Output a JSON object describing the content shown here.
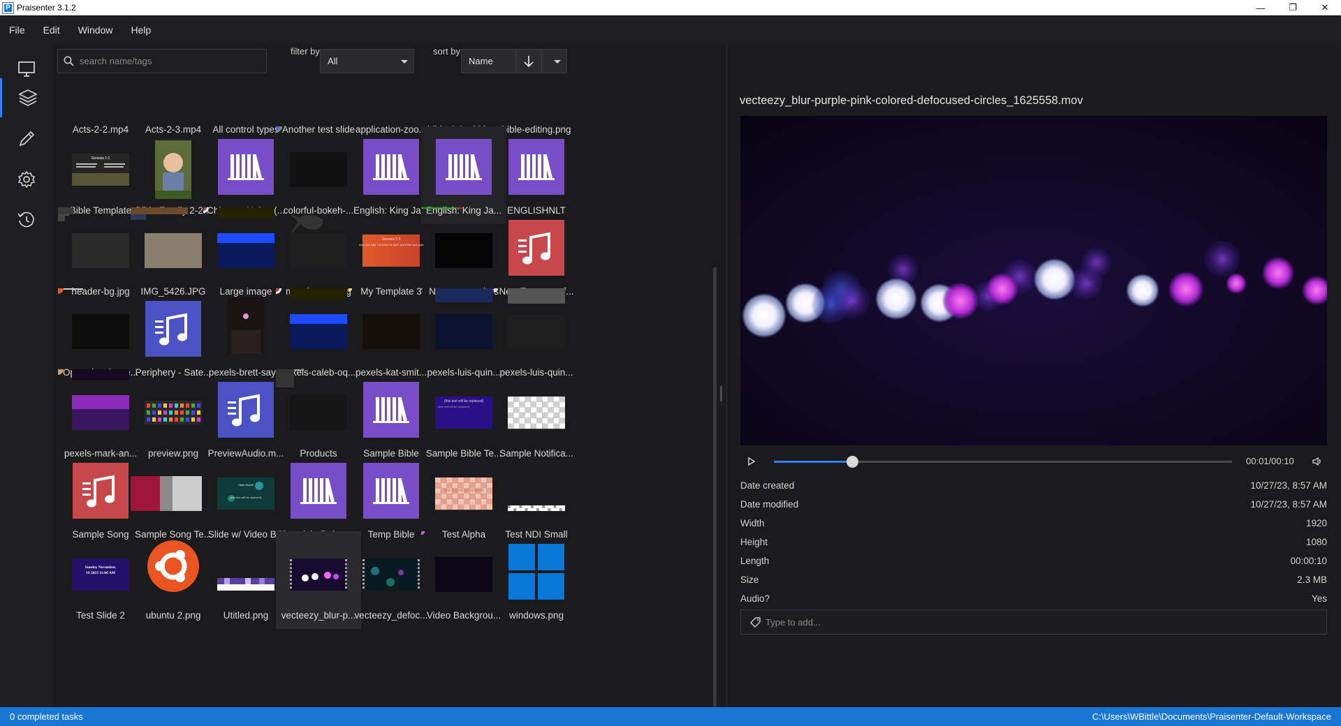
{
  "window": {
    "title": "Praisenter 3.1.2",
    "minimize": "—",
    "maximize": "❐",
    "close": "✕"
  },
  "menu": [
    "File",
    "Edit",
    "Window",
    "Help"
  ],
  "rail": [
    {
      "name": "presentation-icon"
    },
    {
      "name": "library-icon",
      "active": true
    },
    {
      "name": "edit-icon"
    },
    {
      "name": "settings-icon"
    },
    {
      "name": "history-icon"
    }
  ],
  "toolbar": {
    "search_placeholder": "search name/tags",
    "filter_label": "filter by",
    "filter_value": "All",
    "sort_label": "sort by",
    "sort_value": "Name"
  },
  "library": {
    "items": [
      {
        "label": "Acts-2-2.mp4",
        "kind": "video-strip"
      },
      {
        "label": "Acts-2-3.mp4",
        "kind": "video-strip"
      },
      {
        "label": "All control types",
        "kind": "orange-strip"
      },
      {
        "label": "Another test slide",
        "kind": "dark-strip"
      },
      {
        "label": "application-zoo...",
        "kind": "purple-strip"
      },
      {
        "label": "bible-1.1s-200p...",
        "kind": "dark-strip"
      },
      {
        "label": "bible-editing.png",
        "kind": "purple-strip"
      },
      {
        "label": "Bible Template",
        "kind": "bible-template"
      },
      {
        "label": "Bible Family 2-2...",
        "kind": "photo-baby"
      },
      {
        "label": "Chinese: Union (...",
        "kind": "bible"
      },
      {
        "label": "colorful-bokeh-...",
        "kind": "bokeh"
      },
      {
        "label": "English: King Ja...",
        "kind": "bible"
      },
      {
        "label": "English: King Ja...",
        "kind": "bible",
        "state": "hover"
      },
      {
        "label": "ENGLISHNLT",
        "kind": "bible"
      },
      {
        "label": "header-bg.jpg",
        "kind": "photo-dark"
      },
      {
        "label": "IMG_5426.JPG",
        "kind": "photo-kid"
      },
      {
        "label": "Large image",
        "kind": "concert-blue"
      },
      {
        "label": "map-image.png",
        "kind": "map"
      },
      {
        "label": "My Template 3",
        "kind": "orange-template"
      },
      {
        "label": "Nasty text colors",
        "kind": "nasty"
      },
      {
        "label": "New Test song f...",
        "kind": "song-red"
      },
      {
        "label": "Operating Syste...",
        "kind": "os"
      },
      {
        "label": "Periphery - Sate...",
        "kind": "song-blue"
      },
      {
        "label": "pexels-brett-say...",
        "kind": "photo-stage"
      },
      {
        "label": "pexels-caleb-oq...",
        "kind": "concert-blue"
      },
      {
        "label": "pexels-kat-smit...",
        "kind": "bokeh-gold"
      },
      {
        "label": "pexels-luis-quin...",
        "kind": "crowd-blue"
      },
      {
        "label": "pexels-luis-quin...",
        "kind": "crowd-bw"
      },
      {
        "label": "pexels-mark-an...",
        "kind": "concert-purple"
      },
      {
        "label": "preview.png",
        "kind": "icons-grid"
      },
      {
        "label": "PreviewAudio.m...",
        "kind": "song-blue"
      },
      {
        "label": "Products",
        "kind": "products"
      },
      {
        "label": "Sample Bible",
        "kind": "bible"
      },
      {
        "label": "Sample Bible Te...",
        "kind": "bible-text"
      },
      {
        "label": "Sample Notifica...",
        "kind": "checker"
      },
      {
        "label": "Sample Song",
        "kind": "song-red"
      },
      {
        "label": "Sample Song Te...",
        "kind": "song-template"
      },
      {
        "label": "Slide w/ Video BG",
        "kind": "video-bg"
      },
      {
        "label": "Spanish: Reina ...",
        "kind": "bible"
      },
      {
        "label": "Temp Bible",
        "kind": "bible"
      },
      {
        "label": "Test Alpha",
        "kind": "alpha"
      },
      {
        "label": "Test NDI Small",
        "kind": "ndi"
      },
      {
        "label": "Test Slide 2",
        "kind": "test-slide"
      },
      {
        "label": "ubuntu 2.png",
        "kind": "ubuntu"
      },
      {
        "label": "Utitled.png",
        "kind": "utitled"
      },
      {
        "label": "vecteezy_blur-p...",
        "kind": "video-purple",
        "state": "selected"
      },
      {
        "label": "vecteezy_defoc...",
        "kind": "video-teal"
      },
      {
        "label": "Video Backgrou...",
        "kind": "bokeh-purple"
      },
      {
        "label": "windows.png",
        "kind": "windows"
      }
    ],
    "thumb_text": {
      "bible_template_heading": "Genesis 1:1",
      "my_template_heading": "Genesis 1:3",
      "my_template_body": "And God said, Let there be light: and there was light",
      "replaced": "[this text will be replaced]",
      "hello_world": "Hello World!",
      "test_slide_line1": "Sunday November,",
      "test_slide_line2": "19 2023 11:06 AM"
    }
  },
  "preview": {
    "filename": "vecteezy_blur-purple-pink-colored-defocused-circles_1625558.mov",
    "progress": 0.17,
    "time": "00:01/00:10",
    "properties": [
      {
        "key": "Date created",
        "value": "10/27/23, 8:57 AM"
      },
      {
        "key": "Date modified",
        "value": "10/27/23, 8:57 AM"
      },
      {
        "key": "Width",
        "value": "1920"
      },
      {
        "key": "Height",
        "value": "1080"
      },
      {
        "key": "Length",
        "value": "00:00:10"
      },
      {
        "key": "Size",
        "value": "2.3 MB"
      },
      {
        "key": "Audio?",
        "value": "Yes"
      }
    ],
    "tags_placeholder": "Type to add..."
  },
  "status": {
    "left": "0 completed tasks",
    "right": "C:\\Users\\WBittle\\Documents\\Praisenter-Default-Workspace"
  },
  "colors": {
    "accent": "#2f7ef3",
    "statusbar": "#1976d2",
    "bible": "#7a4dc8",
    "song_red": "#c8474a",
    "song_blue": "#4b52c4"
  }
}
